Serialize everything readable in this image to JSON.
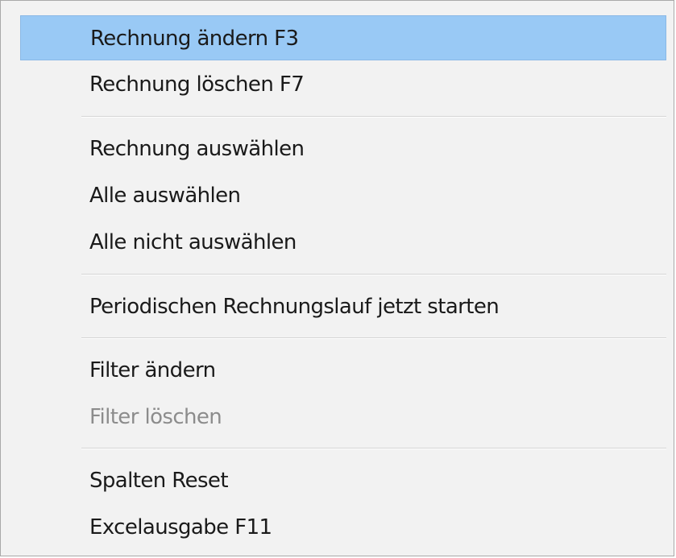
{
  "context_menu": {
    "highlight_color": "#99c9f5",
    "items": [
      {
        "label": "Rechnung ändern F3",
        "state": "highlighted"
      },
      {
        "label": "Rechnung löschen F7",
        "state": "normal"
      },
      {
        "label": "Rechnung auswählen",
        "state": "normal"
      },
      {
        "label": "Alle auswählen",
        "state": "normal"
      },
      {
        "label": "Alle nicht auswählen",
        "state": "normal"
      },
      {
        "label": "Periodischen Rechnungslauf jetzt starten",
        "state": "normal"
      },
      {
        "label": "Filter ändern",
        "state": "normal"
      },
      {
        "label": "Filter löschen",
        "state": "disabled"
      },
      {
        "label": "Spalten Reset",
        "state": "normal"
      },
      {
        "label": "Excelausgabe F11",
        "state": "normal"
      }
    ]
  }
}
